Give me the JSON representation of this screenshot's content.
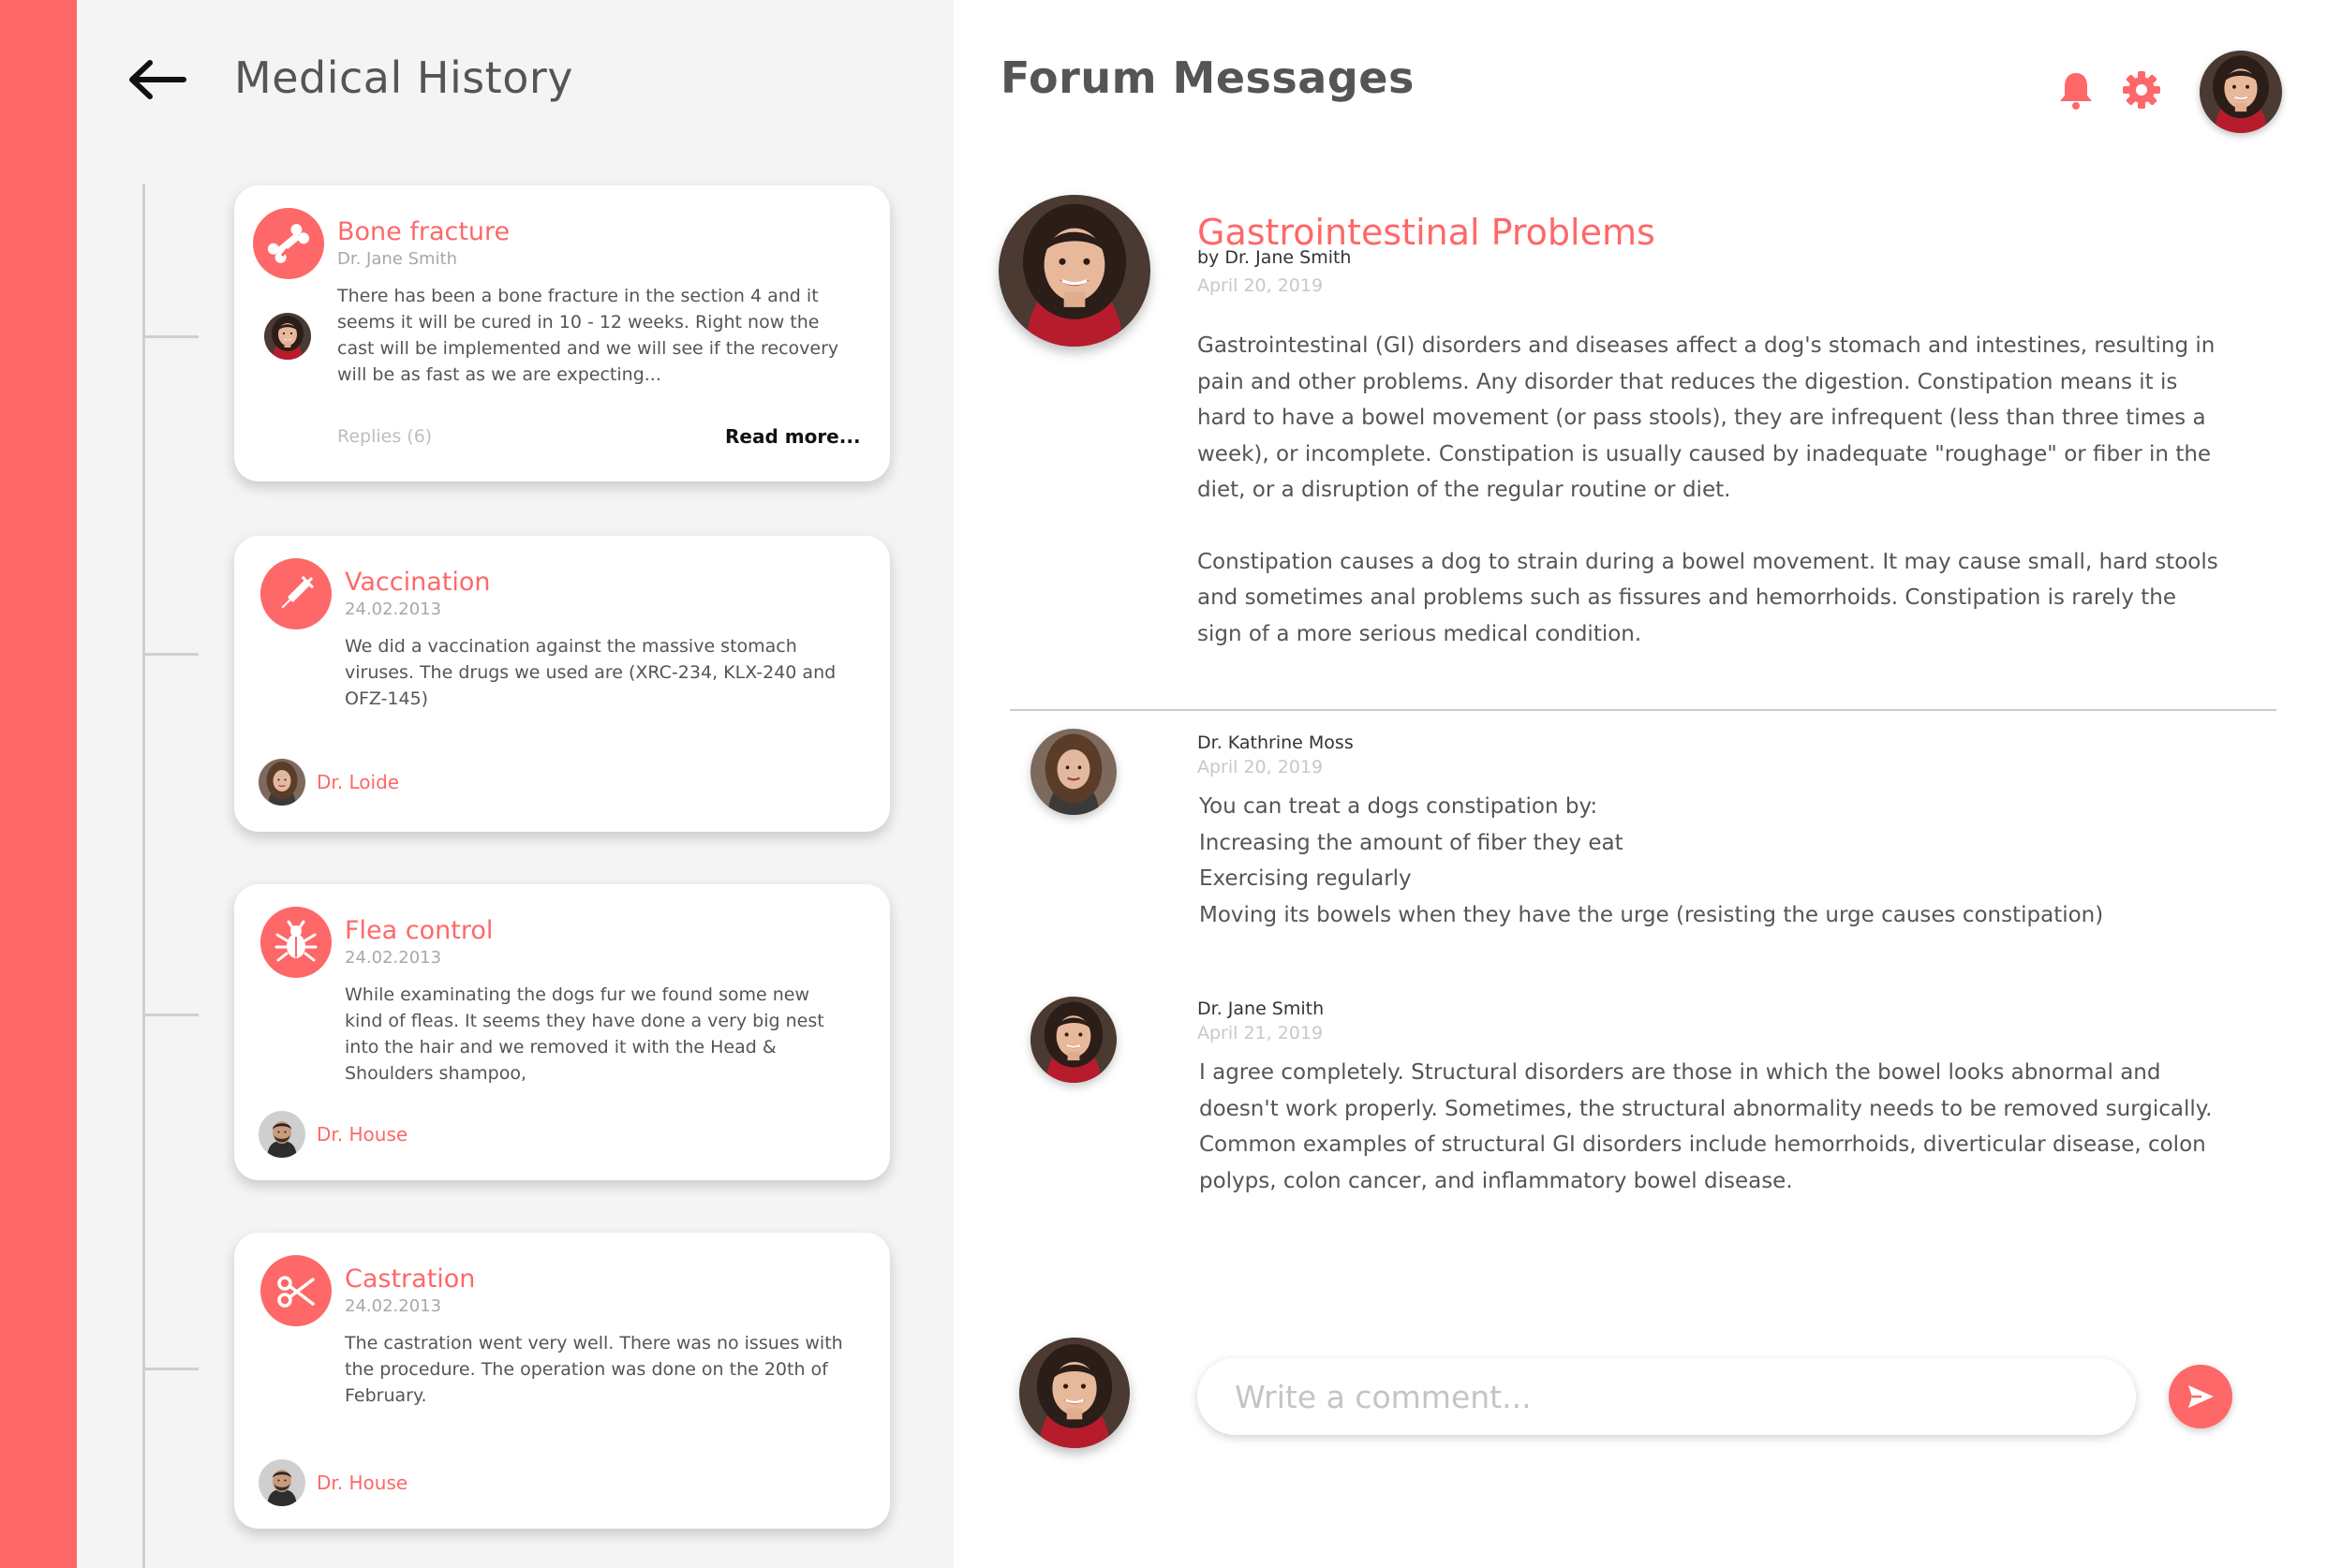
{
  "colors": {
    "accent": "#fe6868",
    "panel_bg": "#f4f4f4",
    "text": "#555555",
    "muted": "#c8c8c8"
  },
  "history": {
    "title": "Medical History",
    "cards": [
      {
        "icon": "bone-icon",
        "title": "Bone fracture",
        "subtitle": "Dr. Jane Smith",
        "body": "There has been a bone fracture in the section 4 and it seems it will be cured in 10 - 12 weeks. Right now the cast will be implemented and we will see if the recovery will be as fast as we are expecting...",
        "replies": "Replies (6)",
        "read_more": "Read more..."
      },
      {
        "icon": "syringe-icon",
        "title": "Vaccination",
        "subtitle": "24.02.2013",
        "body": "We did a vaccination against the massive stomach viruses. The drugs we used are (XRC-234, KLX-240 and OFZ-145)",
        "author": "Dr. Loide"
      },
      {
        "icon": "bug-icon",
        "title": "Flea control",
        "subtitle": "24.02.2013",
        "body": "While examinating the dogs fur we found some new kind of fleas. It seems they have done a very big nest into the hair and we removed it with the Head & Shoulders shampoo,",
        "author": "Dr. House"
      },
      {
        "icon": "scissors-icon",
        "title": "Castration",
        "subtitle": "24.02.2013",
        "body": "The castration went very well. There was no issues with the procedure. The operation was done on the 20th of February.",
        "author": "Dr. House"
      }
    ]
  },
  "forum": {
    "title": "Forum Messages",
    "post": {
      "title": "Gastrointestinal Problems",
      "author": "by Dr. Jane Smith",
      "date": "April 20, 2019",
      "paragraphs": [
        "Gastrointestinal (GI) disorders and diseases affect a dog's stomach and intestines, resulting in pain and other problems. Any disorder that reduces the digestion. Constipation means it is hard to have a bowel movement (or pass stools), they are infrequent (less than three times a week), or incomplete. Constipation is usually caused by inadequate \"roughage\" or fiber in the diet, or a disruption of the regular routine or diet.",
        "Constipation causes a dog to strain during a bowel movement. It may cause small, hard stools and sometimes anal problems such as fissures and hemorrhoids. Constipation is rarely the sign of a more serious medical condition."
      ]
    },
    "replies": [
      {
        "author": "Dr. Kathrine Moss",
        "date": "April 20, 2019",
        "lines": [
          "You can treat a dogs constipation by:",
          "Increasing the amount of fiber they eat",
          "Exercising regularly",
          "Moving its bowels when they have the urge (resisting the urge causes constipation)"
        ]
      },
      {
        "author": "Dr. Jane Smith",
        "date": "April 21, 2019",
        "text": "I agree completely. Structural disorders are those in which the bowel looks abnormal and doesn't work properly. Sometimes, the structural abnormality needs to be removed surgically. Common examples of structural GI disorders include hemorrhoids, diverticular disease, colon polyps, colon cancer, and inflammatory bowel disease."
      }
    ],
    "comment": {
      "placeholder": "Write a comment..."
    }
  },
  "icons": {
    "back": "arrow-left-icon",
    "notifications": "bell-icon",
    "settings": "gear-icon",
    "send": "send-icon"
  }
}
